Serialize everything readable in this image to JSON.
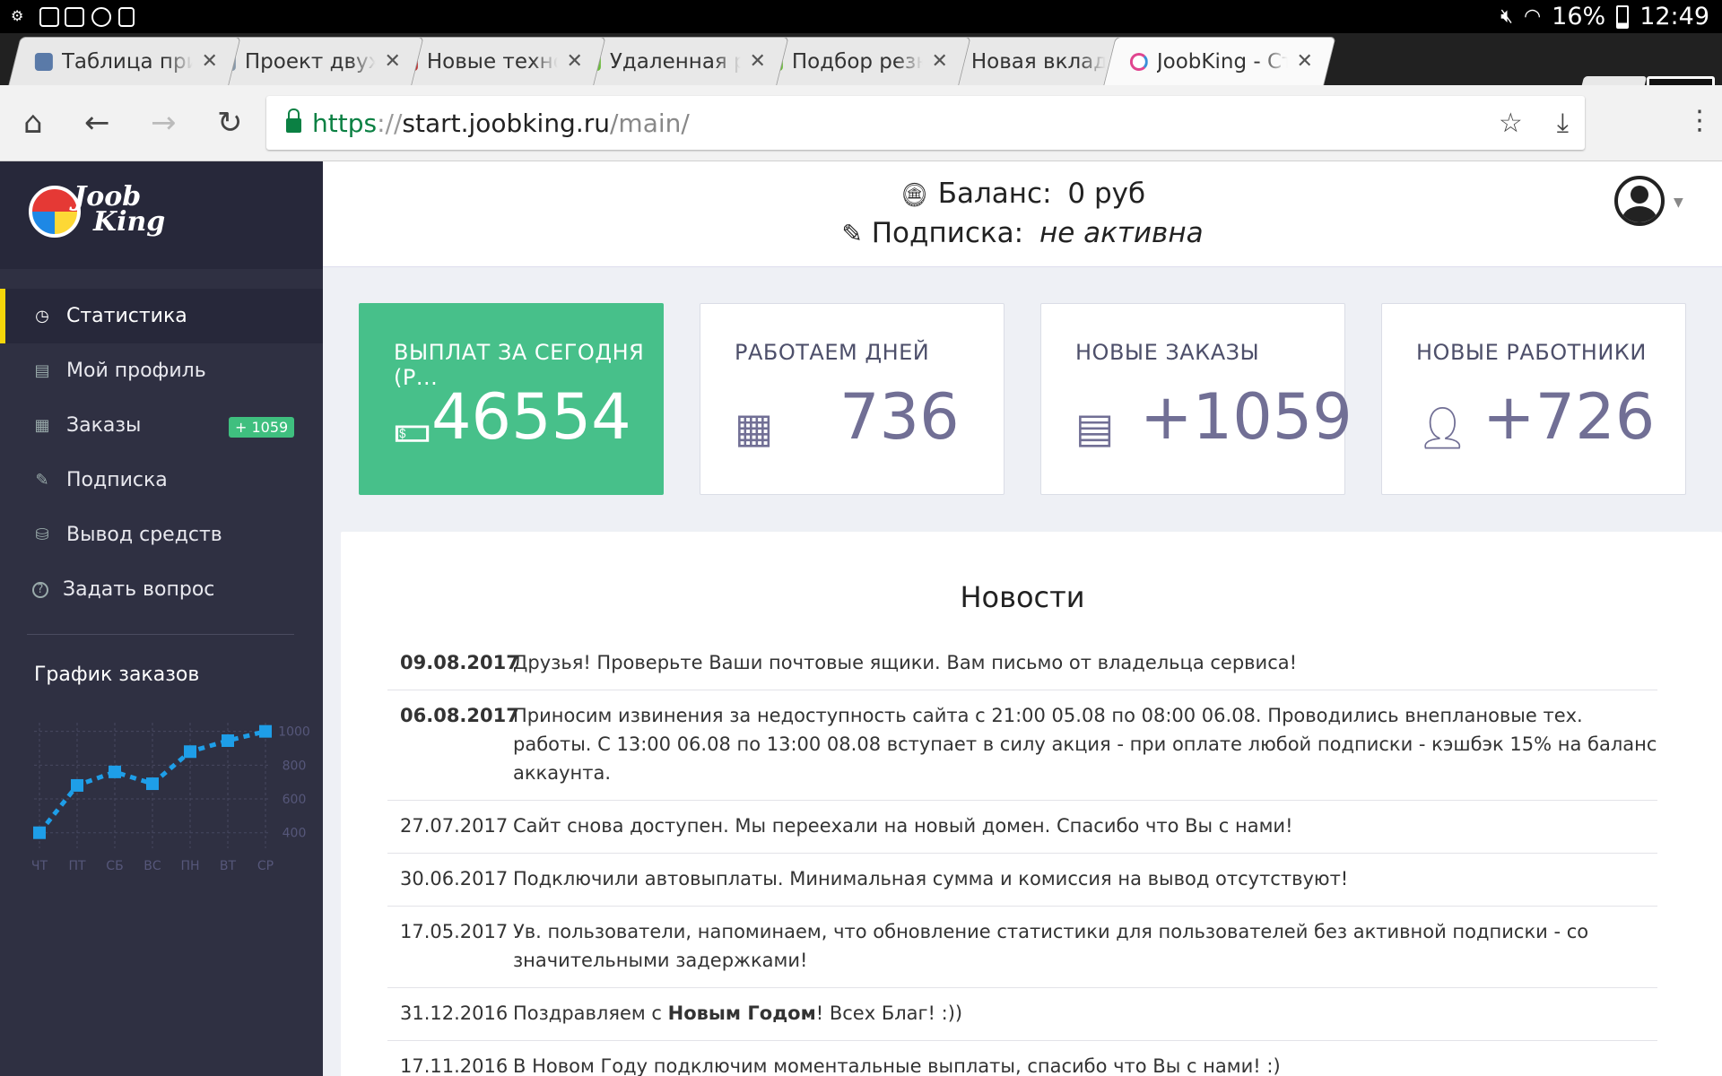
{
  "status_bar": {
    "battery": "16%",
    "time": "12:49"
  },
  "tabs": [
    {
      "title": "Таблица прико",
      "favicon": "spiral-icon",
      "active": false
    },
    {
      "title": "Проект двухэт",
      "favicon": "house-icon",
      "active": false
    },
    {
      "title": "Новые техноло",
      "favicon": "flower-icon",
      "active": false
    },
    {
      "title": "Удаленная раб",
      "favicon": "FL",
      "active": false
    },
    {
      "title": "Подбор резюм",
      "favicon": "FL",
      "active": false
    },
    {
      "title": "Новая вкладка",
      "favicon": "page-icon",
      "active": false
    },
    {
      "title": "JoobKing - Ста",
      "favicon": "circle-icon",
      "active": true
    }
  ],
  "url": {
    "scheme": "https",
    "sep": "://",
    "host": "start.joobking.ru",
    "path": "/main/"
  },
  "logo": {
    "line1": "Joob",
    "line2": "King"
  },
  "header": {
    "balance_label": "Баланс:",
    "balance_value": "0 руб",
    "subscription_label": "Подписка:",
    "subscription_value": "не активна"
  },
  "nav": [
    {
      "label": "Статистика",
      "icon": "dashboard-icon",
      "active": true
    },
    {
      "label": "Мой профиль",
      "icon": "id-card-icon",
      "active": false
    },
    {
      "label": "Заказы",
      "icon": "orders-icon",
      "active": false,
      "badge": "+ 1059"
    },
    {
      "label": "Подписка",
      "icon": "pencil-icon",
      "active": false
    },
    {
      "label": "Вывод средств",
      "icon": "coins-icon",
      "active": false
    },
    {
      "label": "Задать вопрос",
      "icon": "question-icon",
      "active": false
    }
  ],
  "chart_title": "График заказов",
  "chart_data": {
    "type": "line",
    "categories": [
      "ЧТ",
      "ПТ",
      "СБ",
      "ВС",
      "ПН",
      "ВТ",
      "СР"
    ],
    "values": [
      400,
      680,
      760,
      690,
      880,
      945,
      1000
    ],
    "yticks": [
      400,
      600,
      800,
      1000
    ],
    "ylim": [
      340,
      1030
    ],
    "grid": true,
    "color": "#1e9ee8"
  },
  "cards": [
    {
      "label": "ВЫПЛАТ ЗА СЕГОДНЯ (Р...",
      "value": "46554",
      "icon": "money-icon",
      "color": "#47c08a"
    },
    {
      "label": "РАБОТАЕМ ДНЕЙ",
      "value": "736",
      "icon": "calendar-icon"
    },
    {
      "label": "НОВЫЕ ЗАКАЗЫ",
      "value": "+1059",
      "icon": "new-orders-icon"
    },
    {
      "label": "НОВЫЕ РАБОТНИКИ",
      "value": "+726",
      "icon": "users-icon"
    }
  ],
  "news_title": "Новости",
  "news": [
    {
      "date": "09.08.2017",
      "text": "Друзья! Проверьте Ваши почтовые ящики. Вам письмо от владельца сервиса!",
      "bold": true
    },
    {
      "date": "06.08.2017",
      "text": "Приносим извинения за недоступность сайта с 21:00 05.08 по 08:00 06.08. Проводились внеплановые тех. работы. С 13:00 06.08 по 13:00 08.08 вступает в силу акция - при оплате любой подписки - кэшбэк 15% на баланс аккаунта.",
      "bold": true
    },
    {
      "date": "27.07.2017",
      "text": "Сайт снова доступен. Мы переехали на новый домен. Спасибо что Вы с нами!",
      "bold": false
    },
    {
      "date": "30.06.2017",
      "text": "Подключили автовыплаты. Минимальная сумма и комиссия на вывод отсутствуют!",
      "bold": false
    },
    {
      "date": "17.05.2017",
      "text": "Ув. пользователи, напоминаем, что обновление статистики для пользователей без активной подписки - со значительными задержками!",
      "bold": false
    },
    {
      "date": "31.12.2016",
      "text_before": "Поздравляем с ",
      "text_bold": "Новым Годом",
      "text_after": "! Всех Благ! :))",
      "bold": false
    },
    {
      "date": "17.11.2016",
      "text": "В Новом Году подключим моментальные выплаты, спасибо что Вы с нами! :)",
      "bold": false
    }
  ]
}
